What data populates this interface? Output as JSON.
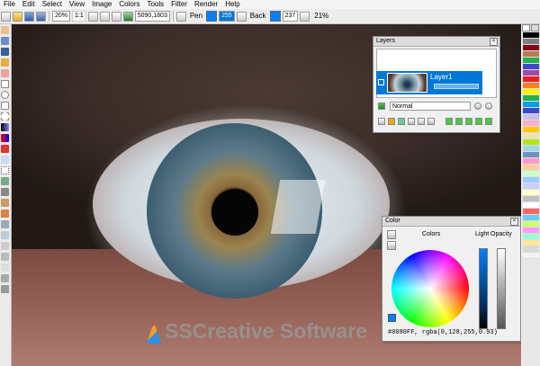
{
  "menu": [
    "File",
    "Edit",
    "Select",
    "View",
    "Image",
    "Colors",
    "Tools",
    "Filter",
    "Render",
    "Help"
  ],
  "toolbar": {
    "zoom": "20%",
    "ratio": "1:1",
    "size": "5090,1803",
    "pen_label": "Pen",
    "pen_value": "255",
    "back_label": "Back",
    "back_value": "237",
    "percent": "21%"
  },
  "layers_panel": {
    "title": "Layers",
    "layer_name": "Layer1",
    "blend_mode": "Normal"
  },
  "color_panel": {
    "title": "Color",
    "colors_label": "Colors",
    "light_label": "Light",
    "opacity_label": "Opacity",
    "value_text": "#0080FF, rgba(0,128,255,0.93)"
  },
  "watermark": "SSCreative Software",
  "colors": {
    "pen": "#0080FF",
    "selection": "#0078D7"
  },
  "palette": [
    "#000000",
    "#7f7f7f",
    "#880015",
    "#b97a57",
    "#22b14c",
    "#3f48cc",
    "#a349a4",
    "#ed1c24",
    "#ff7f27",
    "#fff200",
    "#22b14c",
    "#00a2e8",
    "#3f48cc",
    "#c8bfe7",
    "#ffaec9",
    "#ffc90e",
    "#efe4b0",
    "#b5e61d",
    "#99d9ea",
    "#7092be",
    "#ff99cc",
    "#ffcc99",
    "#ccffcc",
    "#99ccff",
    "#ccccff",
    "#ffffcc",
    "#c0c0c0",
    "#ffffff",
    "#ff6666",
    "#66ccff",
    "#ccff66",
    "#ff99ff",
    "#99ffcc",
    "#ffe699",
    "#d9d9d9",
    "#f2f2f2"
  ]
}
